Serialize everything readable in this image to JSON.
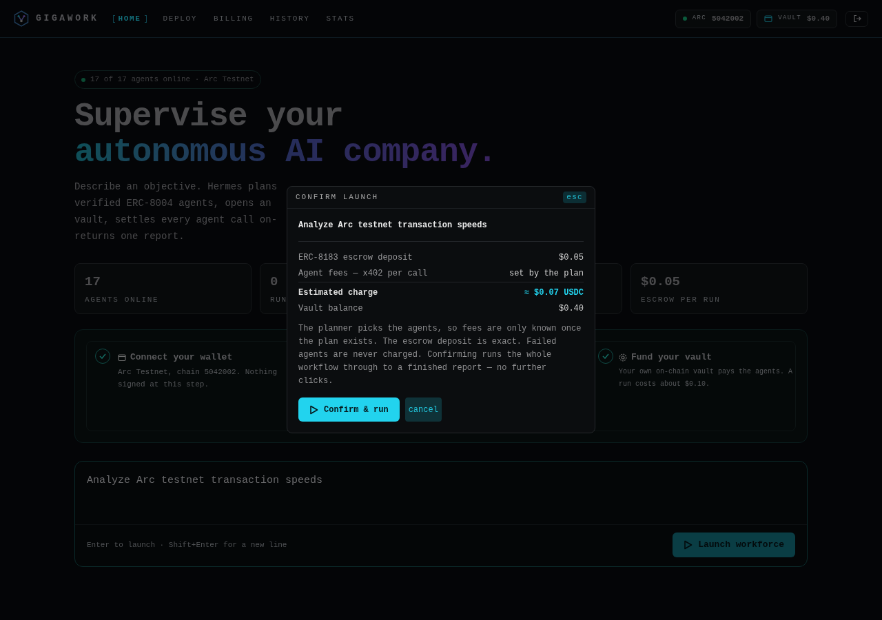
{
  "header": {
    "brand": "GIGAWORK",
    "nav": [
      {
        "label": "HOME",
        "selected": true
      },
      {
        "label": "DEPLOY",
        "selected": false
      },
      {
        "label": "BILLING",
        "selected": false
      },
      {
        "label": "HISTORY",
        "selected": false
      },
      {
        "label": "STATS",
        "selected": false
      }
    ],
    "chain": {
      "label": "ARC",
      "value": "5042002"
    },
    "vault": {
      "label": "VAULT",
      "value": "$0.40"
    }
  },
  "hero": {
    "status": "17 of 17 agents online · Arc Testnet",
    "headline_line1": "Supervise your",
    "headline_line2": "autonomous AI company.",
    "description_lines": [
      "Describe an objective. Hermes plans",
      "verified ERC-8004 agents, opens an",
      "vault, settles every agent call on-",
      "returns one report."
    ]
  },
  "stats": [
    {
      "value": "17",
      "label": "AGENTS ONLINE"
    },
    {
      "value": "0",
      "label": "RUN"
    },
    {
      "value": "$0.05",
      "label": "ESCROW PER RUN"
    }
  ],
  "steps": [
    {
      "done": true,
      "title": "Connect your wallet",
      "lines": [
        "Arc Testnet, chain 5042002. Nothing",
        "signed at this step."
      ]
    },
    {
      "done": true,
      "title": "Fund your vault",
      "lines": [
        "Your own on-chain vault pays the agents. A",
        "run costs about $0.10."
      ]
    }
  ],
  "prompt": {
    "value": "Analyze Arc testnet transaction speeds",
    "hint": "Enter to launch · Shift+Enter for a new line",
    "button": "Launch workforce"
  },
  "modal": {
    "title": "CONFIRM LAUNCH",
    "close": "esc",
    "objective": "Analyze Arc testnet transaction speeds",
    "rows": [
      {
        "kind": "line",
        "label": "ERC-8183 escrow deposit",
        "value": "$0.05"
      },
      {
        "kind": "line",
        "label": "Agent fees — x402 per call",
        "value": "set by the plan"
      },
      {
        "kind": "total",
        "label": "Estimated charge",
        "value": "≈ $0.07 USDC"
      },
      {
        "kind": "line",
        "label": "Vault balance",
        "value": "$0.40"
      }
    ],
    "note": "The planner picks the agents, so fees are only known once the plan exists. The escrow deposit is exact. Failed agents are never charged. Confirming runs the whole workflow through to a finished report — no further clicks.",
    "confirm": "Confirm & run",
    "cancel": "cancel"
  }
}
